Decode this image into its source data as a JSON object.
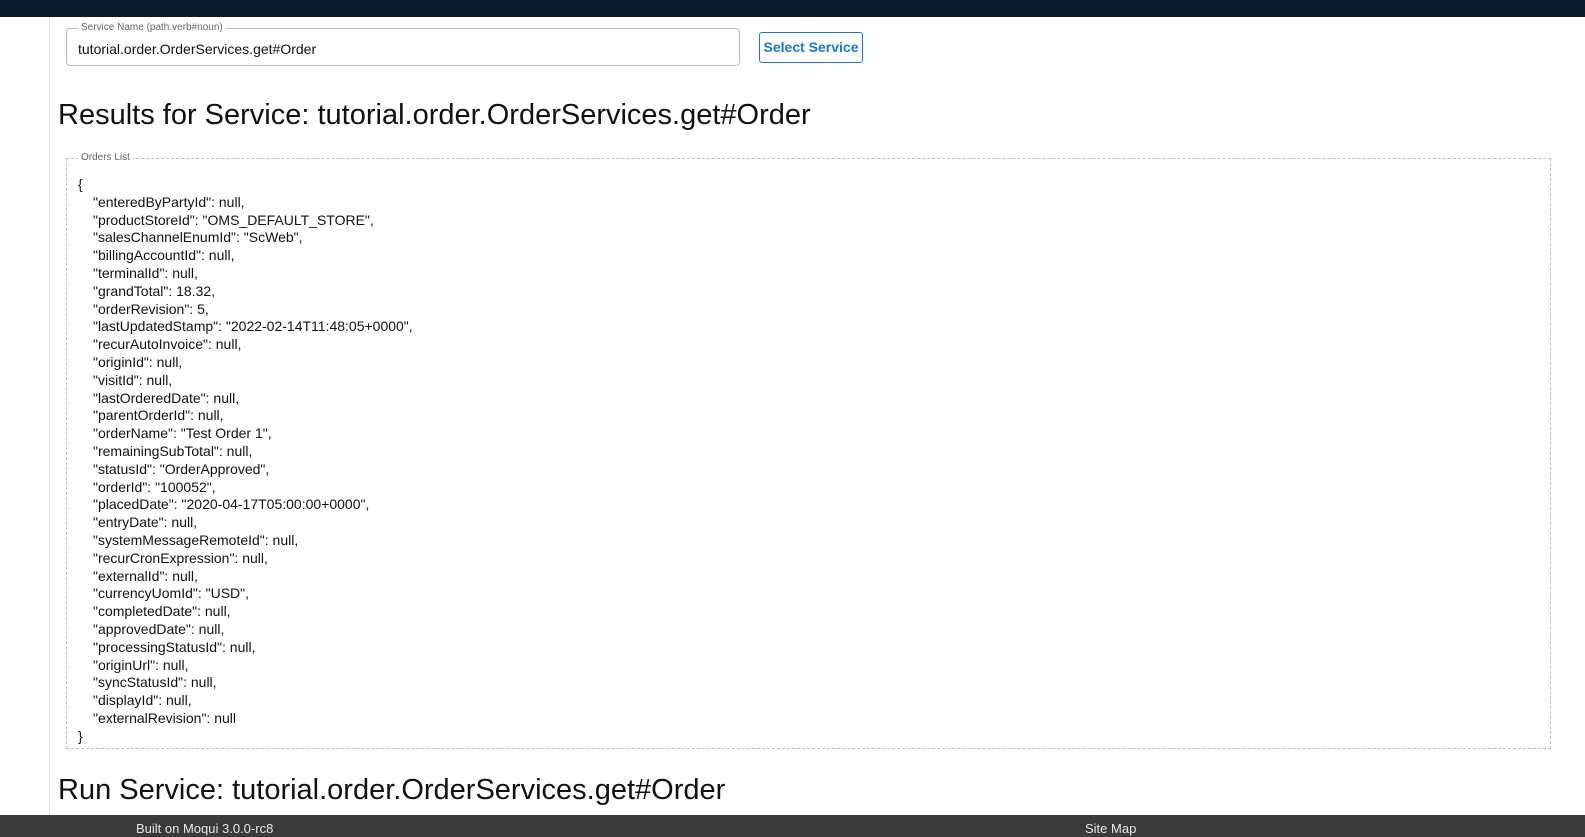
{
  "service_field": {
    "label": "Service Name (path.verb#noun)",
    "value": "tutorial.order.OrderServices.get#Order"
  },
  "select_button": "Select Service",
  "results_heading": "Results for Service: tutorial.order.OrderServices.get#Order",
  "orders_list": {
    "legend": "Orders List",
    "open_brace": "{",
    "lines": [
      "\"enteredByPartyId\": null,",
      "\"productStoreId\": \"OMS_DEFAULT_STORE\",",
      "\"salesChannelEnumId\": \"ScWeb\",",
      "\"billingAccountId\": null,",
      "\"terminalId\": null,",
      "\"grandTotal\": 18.32,",
      "\"orderRevision\": 5,",
      "\"lastUpdatedStamp\": \"2022-02-14T11:48:05+0000\",",
      "\"recurAutoInvoice\": null,",
      "\"originId\": null,",
      "\"visitId\": null,",
      "\"lastOrderedDate\": null,",
      "\"parentOrderId\": null,",
      "\"orderName\": \"Test Order 1\",",
      "\"remainingSubTotal\": null,",
      "\"statusId\": \"OrderApproved\",",
      "\"orderId\": \"100052\",",
      "\"placedDate\": \"2020-04-17T05:00:00+0000\",",
      "\"entryDate\": null,",
      "\"systemMessageRemoteId\": null,",
      "\"recurCronExpression\": null,",
      "\"externalId\": null,",
      "\"currencyUomId\": \"USD\",",
      "\"completedDate\": null,",
      "\"approvedDate\": null,",
      "\"processingStatusId\": null,",
      "\"originUrl\": null,",
      "\"syncStatusId\": null,",
      "\"displayId\": null,",
      "\"externalRevision\": null"
    ],
    "close_brace": "}"
  },
  "run_heading": "Run Service: tutorial.order.OrderServices.get#Order",
  "footer": {
    "built_on": "Built on Moqui 3.0.0-rc8",
    "site_map": "Site Map"
  }
}
